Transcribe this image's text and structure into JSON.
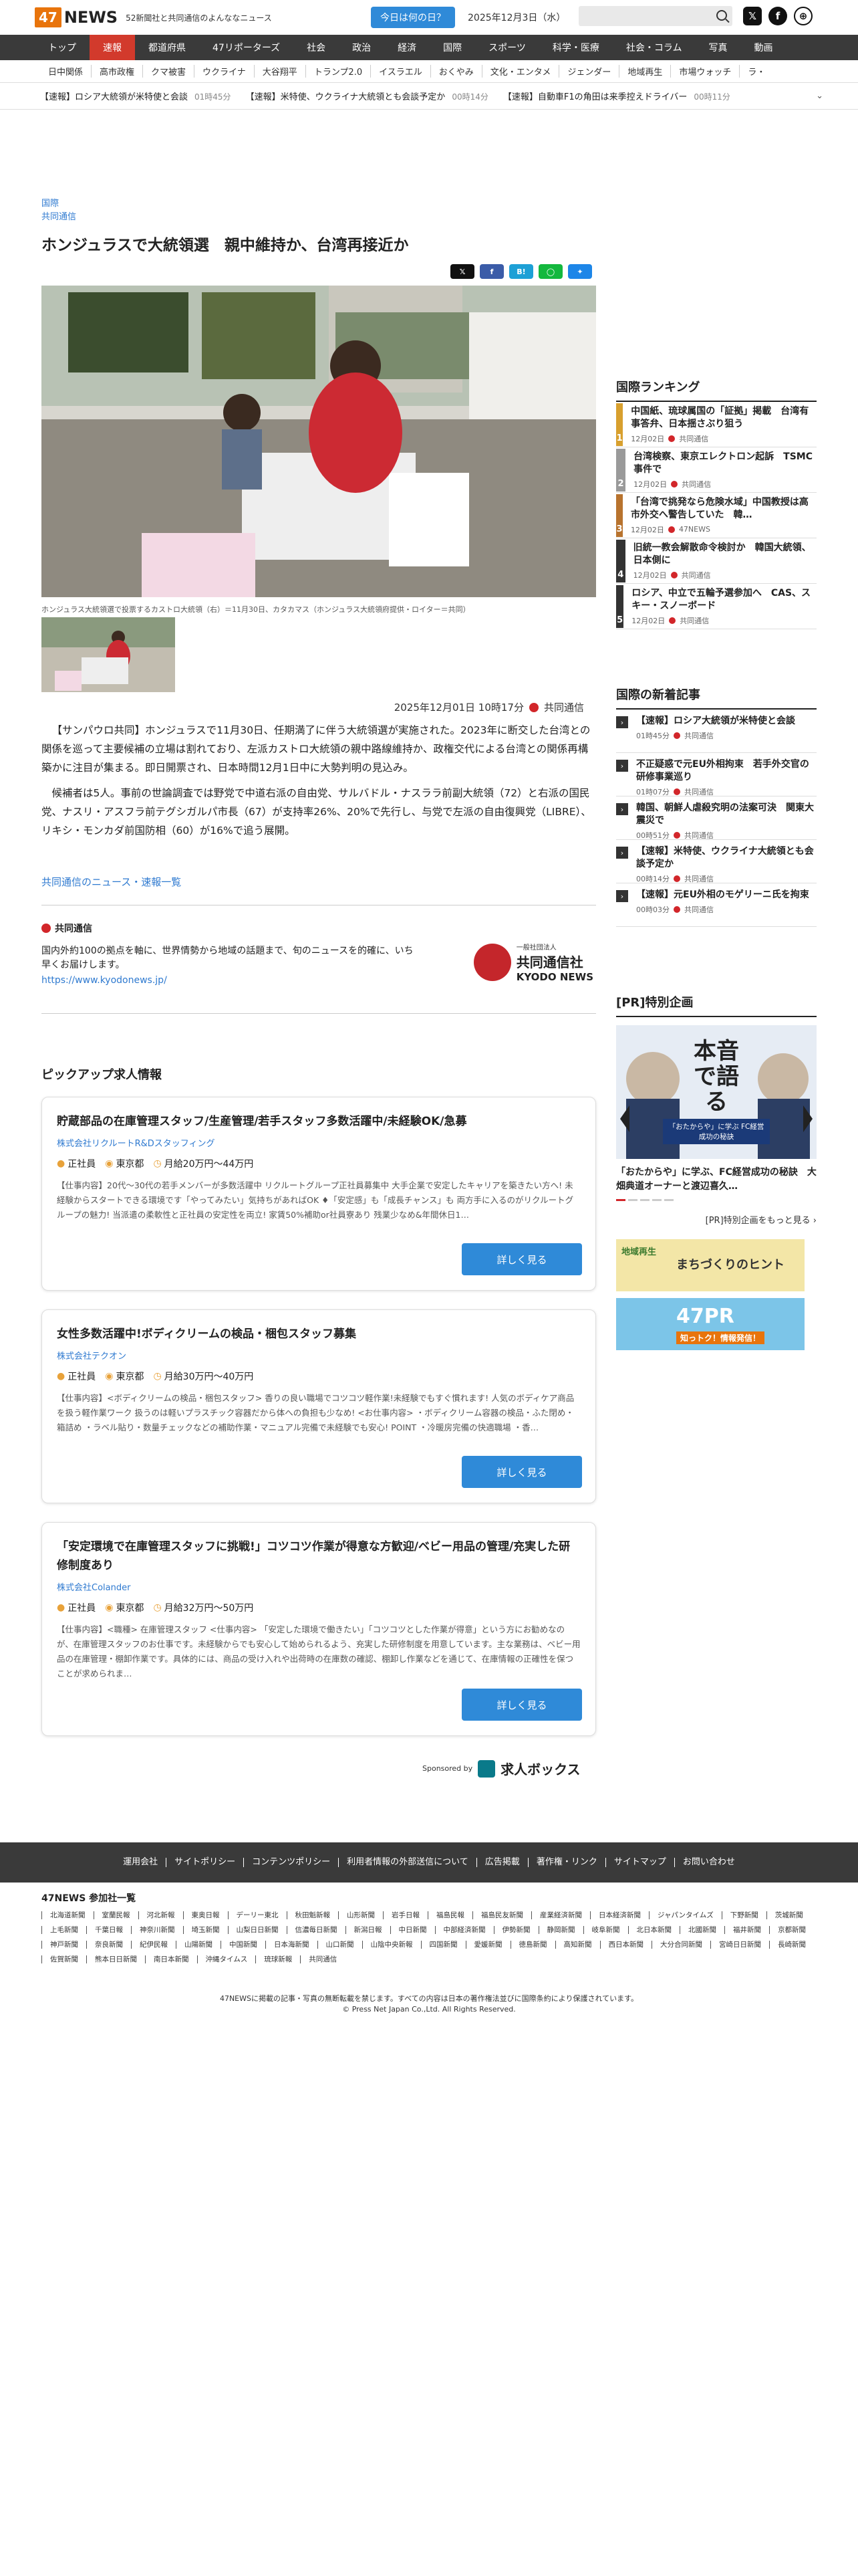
{
  "header": {
    "logo_num": "47",
    "logo_text": "NEWS",
    "tagline": "52新聞社と共同通信のよんななニュース",
    "today_button": "今日は何の日？",
    "date": "2025年12月3日（水）"
  },
  "main_nav": [
    "トップ",
    "速報",
    "都道府県",
    "47リポーターズ",
    "社会",
    "政治",
    "経済",
    "国際",
    "スポーツ",
    "科学・医療",
    "社会・コラム",
    "写真",
    "動画"
  ],
  "sub_nav": [
    "日中関係",
    "高市政権",
    "クマ被害",
    "ウクライナ",
    "大谷翔平",
    "トランプ2.0",
    "イスラエル",
    "おくやみ",
    "文化・エンタメ",
    "ジェンダー",
    "地域再生",
    "市場ウォッチ",
    "ラ・"
  ],
  "ticker": [
    {
      "text": "【速報】ロシア大統領が米特使と会談",
      "time": "01時45分"
    },
    {
      "text": "【速報】米特使、ウクライナ大統領とも会談予定か",
      "time": "00時14分"
    },
    {
      "text": "【速報】自動車F1の角田は来季控えドライバー",
      "time": "00時11分"
    }
  ],
  "article": {
    "category1": "国際",
    "category2": "共同通信",
    "title": "ホンジュラスで大統領選　親中維持か、台湾再接近か",
    "share": [
      "X",
      "f",
      "B!",
      "LINE",
      "bsky"
    ],
    "caption": "ホンジュラス大統領選で投票するカストロ大統領（右）＝11月30日、カタカマス（ホンジュラス大統領府提供・ロイター＝共同）",
    "datetime": "2025年12月01日 10時17分",
    "source": "共同通信",
    "para1": "【サンパウロ共同】ホンジュラスで11月30日、任期満了に伴う大統領選が実施された。2023年に断交した台湾との関係を巡って主要候補の立場は割れており、左派カストロ大統領の親中路線維持か、政権交代による台湾との関係再構築かに注目が集まる。即日開票され、日本時間12月1日中に大勢判明の見込み。",
    "para2": "候補者は5人。事前の世論調査では野党で中道右派の自由党、サルバドル・ナスララ前副大統領（72）と右派の国民党、ナスリ・アスフラ前テグシガルパ市長（67）が支持率26%、20%で先行し、与党で左派の自由復興党（LIBRE）、リキシ・モンカダ前国防相（60）が16%で追う展開。",
    "kyodo_link": "共同通信のニュース・速報一覧",
    "kyodo_head": "共同通信",
    "kyodo_desc": "国内外約100の拠点を軸に、世界情勢から地域の話題まで、旬のニュースを的確に、いち早くお届けします。",
    "kyodo_url": "https://www.kyodonews.jp/",
    "kyodo_logo1": "一般社団法人",
    "kyodo_logo2": "共同通信社",
    "kyodo_logo3": "KYODO NEWS"
  },
  "jobs": {
    "title": "ピックアップ求人情報",
    "items": [
      {
        "title": "貯蔵部品の在庫管理スタッフ/生産管理/若手スタッフ多数活躍中/未経験OK/急募",
        "company": "株式会社リクルートR&Dスタッフィング",
        "type": "正社員",
        "place": "東京都",
        "salary": "月給20万円〜44万円",
        "desc": "【仕事内容】20代〜30代の若手メンバーが多数活躍中 リクルートグループ正社員募集中 大手企業で安定したキャリアを築きたい方へ! 未経験からスタートできる環境です「やってみたい」気持ちがあればOK ♦「安定感」も「成長チャンス」も 両方手に入るのがリクルートグループの魅力! 当派遣の柔軟性と正社員の安定性を両立! 家賃50%補助or社員寮あり 残業少なめ&年間休日1…",
        "button": "詳しく見る"
      },
      {
        "title": "女性多数活躍中!ボディクリームの検品・梱包スタッフ募集",
        "company": "株式会社テクオン",
        "type": "正社員",
        "place": "東京都",
        "salary": "月給30万円〜40万円",
        "desc": "【仕事内容】<ボディクリームの検品・梱包スタッフ> 香りの良い職場でコツコツ軽作業!未経験でもすぐ慣れます! 人気のボディケア商品を扱う軽作業ワーク 扱うのは軽いプラスチック容器だから体への負担も少なめ! <お仕事内容> ・ボディクリーム容器の検品・ふた閉め・箱詰め ・ラベル貼り・数量チェックなどの補助作業・マニュアル完備で未経験でも安心! POINT ・冷暖房完備の快適職場 ・香…",
        "button": "詳しく見る"
      },
      {
        "title": "「安定環境で在庫管理スタッフに挑戦!」コツコツ作業が得意な方歓迎/ベビー用品の管理/充実した研修制度あり",
        "company": "株式会社Colander",
        "type": "正社員",
        "place": "東京都",
        "salary": "月給32万円〜50万円",
        "desc": "【仕事内容】<職種> 在庫管理スタッフ <仕事内容> 「安定した環境で働きたい」「コツコツとした作業が得意」という方にお勧めなのが、在庫管理スタッフのお仕事です。未経験からでも安心して始められるよう、充実した研修制度を用意しています。主な業務は、ベビー用品の在庫管理・棚卸作業です。具体的には、商品の受け入れや出荷時の在庫数の確認、棚卸し作業などを通じて、在庫情報の正確性を保つことが求められま…",
        "button": "詳しく見る"
      }
    ],
    "sponsored_label": "Sponsored by",
    "sponsor_name": "求人ボックス"
  },
  "sidebar": {
    "ranking_title": "国際ランキング",
    "ranking": [
      {
        "num": "1",
        "title": "中国紙、琉球属国の「証拠」掲載　台湾有事答弁、日本揺さぶり狙う",
        "date": "12月02日",
        "source": "共同通信",
        "color": "#d8a02e"
      },
      {
        "num": "2",
        "title": "台湾検察、東京エレクトロン起訴　TSMC事件で",
        "date": "12月02日",
        "source": "共同通信",
        "color": "#9a9a9a"
      },
      {
        "num": "3",
        "title": "「台湾で挑発なら危険水域」中国教授は高市外交へ警告していた　韓…",
        "date": "12月02日",
        "source": "47NEWS",
        "color": "#b8732e"
      },
      {
        "num": "4",
        "title": "旧統一教会解散命令検討か　韓国大統領、日本側に",
        "date": "12月02日",
        "source": "共同通信",
        "color": "#333333"
      },
      {
        "num": "5",
        "title": "ロシア、中立で五輪予選参加へ　CAS、スキー・スノーボード",
        "date": "12月02日",
        "source": "共同通信",
        "color": "#333333"
      }
    ],
    "new_title": "国際の新着記事",
    "new_items": [
      {
        "title": "【速報】ロシア大統領が米特使と会談",
        "time": "01時45分",
        "source": "共同通信"
      },
      {
        "title": "不正疑惑で元EU外相拘束　若手外交官の研修事業巡り",
        "time": "01時07分",
        "source": "共同通信"
      },
      {
        "title": "韓国、朝鮮人虐殺究明の法案可決　関東大震災で",
        "time": "00時51分",
        "source": "共同通信"
      },
      {
        "title": "【速報】米特使、ウクライナ大統領とも会談予定か",
        "time": "00時14分",
        "source": "共同通信"
      },
      {
        "title": "【速報】元EU外相のモゲリーニ氏を拘束",
        "time": "00時03分",
        "source": "共同通信"
      }
    ],
    "pr_title": "[PR]特別企画",
    "pr_banner_big": "本音で語る",
    "pr_banner_sub": "「おたからや」に学ぶ FC経営成功の秘訣",
    "pr_caption": "「おたからや」に学ぶ、FC経営成功の秘訣　大畑典道オーナーと渡辺喜久…",
    "pr_more": "[PR]特別企画をもっと見る",
    "ad1_text": "まちづくりのヒント",
    "ad1_sub": "地域再生",
    "ad2_text": "47PR",
    "ad2_sub": "知っトク！情報発信！"
  },
  "footer": {
    "links": [
      "運用会社",
      "サイトポリシー",
      "コンテンツポリシー",
      "利用者情報の外部送信について",
      "広告掲載",
      "著作権・リンク",
      "サイトマップ",
      "お問い合わせ"
    ],
    "members_title": "47NEWS 参加社一覧",
    "members": [
      "北海道新聞",
      "室蘭民報",
      "河北新報",
      "東奥日報",
      "デーリー東北",
      "秋田魁新報",
      "山形新聞",
      "岩手日報",
      "福島民報",
      "福島民友新聞",
      "産業経済新聞",
      "日本経済新聞",
      "ジャパンタイムズ",
      "下野新聞",
      "茨城新聞",
      "上毛新聞",
      "千葉日報",
      "神奈川新聞",
      "埼玉新聞",
      "山梨日日新聞",
      "信濃毎日新聞",
      "新潟日報",
      "中日新聞",
      "中部経済新聞",
      "伊勢新聞",
      "静岡新聞",
      "岐阜新聞",
      "北日本新聞",
      "北國新聞",
      "福井新聞",
      "京都新聞",
      "神戸新聞",
      "奈良新聞",
      "紀伊民報",
      "山陽新聞",
      "中国新聞",
      "日本海新聞",
      "山口新聞",
      "山陰中央新報",
      "四国新聞",
      "愛媛新聞",
      "徳島新聞",
      "高知新聞",
      "西日本新聞",
      "大分合同新聞",
      "宮崎日日新聞",
      "長崎新聞",
      "佐賀新聞",
      "熊本日日新聞",
      "南日本新聞",
      "沖縄タイムス",
      "琉球新報",
      "共同通信"
    ],
    "copyright1": "47NEWSに掲載の記事・写真の無断転載を禁じます。すべての内容は日本の著作権法並びに国際条約により保護されています。",
    "copyright2": "© Press Net Japan Co.,Ltd. All Rights Reserved."
  },
  "colors": {
    "accent": "#e8740c",
    "nav_active": "#d23a2c",
    "link": "#2f7ad0",
    "button": "#2f8ad8"
  }
}
